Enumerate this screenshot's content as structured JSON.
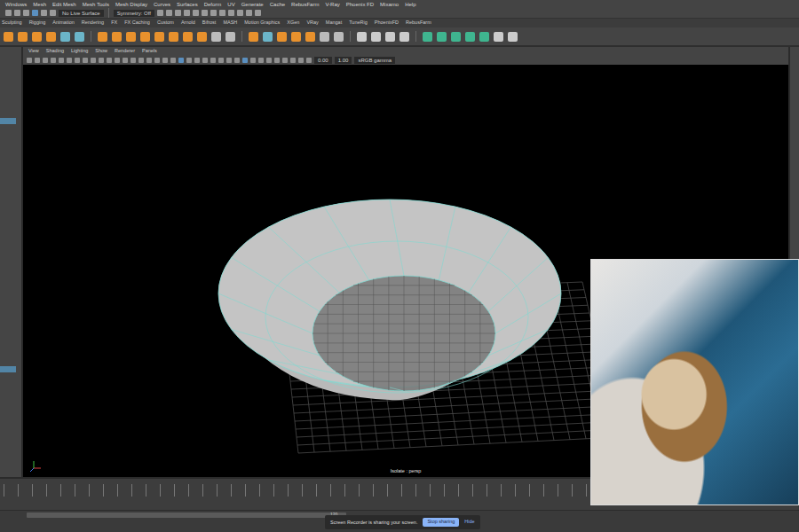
{
  "menu_bar": {
    "items": [
      "Windows",
      "Mesh",
      "Edit Mesh",
      "Mesh Tools",
      "Mesh Display",
      "Curves",
      "Surfaces",
      "Deform",
      "UV",
      "Generate",
      "Cache",
      "RebusFarm",
      "V-Ray",
      "Phoenix FD",
      "Mixamo",
      "Help"
    ]
  },
  "status_line": {
    "live_surface": "No Live Surface",
    "symmetry": "Symmetry: Off"
  },
  "shelf_tabs": [
    {
      "label": "Sculpting",
      "selected": false
    },
    {
      "label": "Rigging",
      "selected": false
    },
    {
      "label": "Animation",
      "selected": false
    },
    {
      "label": "Rendering",
      "selected": false
    },
    {
      "label": "FX",
      "selected": false
    },
    {
      "label": "FX Caching",
      "selected": false
    },
    {
      "label": "Custom",
      "selected": false
    },
    {
      "label": "Arnold",
      "selected": false
    },
    {
      "label": "Bifrost",
      "selected": false
    },
    {
      "label": "MASH",
      "selected": false
    },
    {
      "label": "Motion Graphics",
      "selected": false
    },
    {
      "label": "XGen",
      "selected": false
    },
    {
      "label": "VRay",
      "selected": false
    },
    {
      "label": "Mangat",
      "selected": false
    },
    {
      "label": "TuneRig",
      "selected": false
    },
    {
      "label": "PhoenixFD",
      "selected": false
    },
    {
      "label": "RebusFarm",
      "selected": false
    }
  ],
  "viewport": {
    "menu": [
      "View",
      "Shading",
      "Lighting",
      "Show",
      "Renderer",
      "Panels"
    ],
    "fields": [
      "0.00",
      "1.00"
    ],
    "color_space": "sRGB gamma",
    "label": "Isolate : persp"
  },
  "timeline": {
    "end_frame": "120"
  },
  "screen_share": {
    "message": "Screen Recorder is sharing your screen.",
    "stop": "Stop sharing",
    "hide": "Hide"
  }
}
